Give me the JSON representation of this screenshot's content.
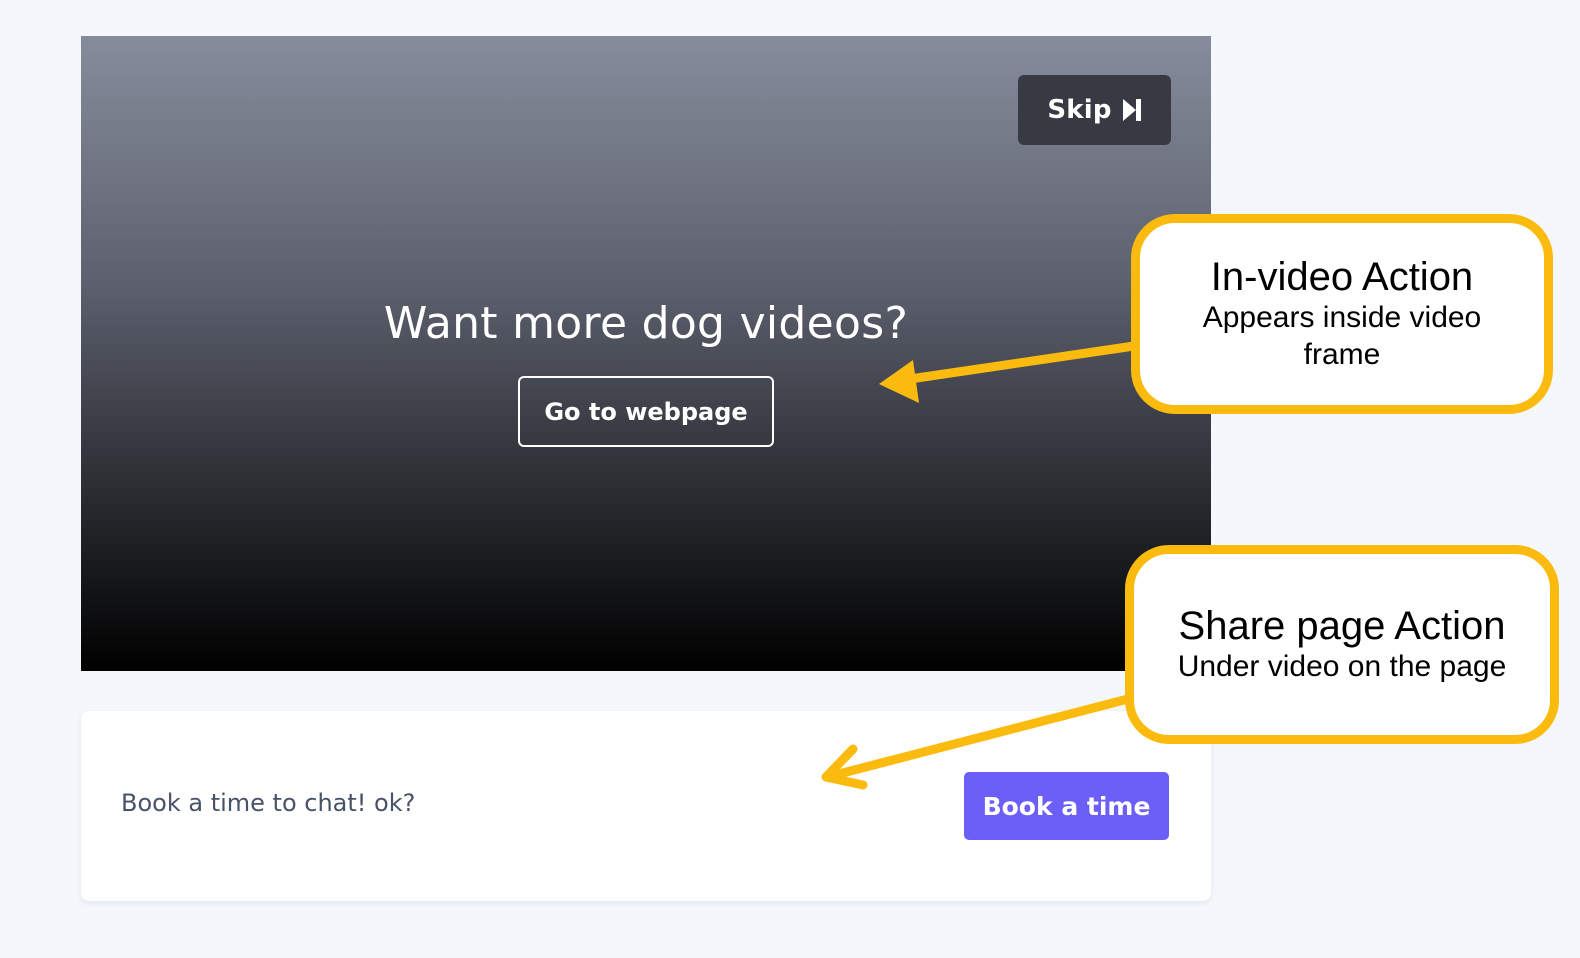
{
  "video": {
    "skip_label": "Skip",
    "skip_icon": "skip-forward-icon",
    "headline": "Want more dog videos?",
    "action_button_label": "Go to webpage"
  },
  "share_page": {
    "text": "Book a time to chat! ok?",
    "button_label": "Book a time"
  },
  "callouts": [
    {
      "title": "In-video Action",
      "subtitle": "Appears inside video frame"
    },
    {
      "title": "Share page Action",
      "subtitle": "Under video on the page"
    }
  ],
  "colors": {
    "page_background": "#f4f7fc",
    "callout_accent": "#fbbb0e",
    "book_button": "#6b5ff7",
    "skip_button": "#373a42",
    "share_text": "#485369"
  }
}
